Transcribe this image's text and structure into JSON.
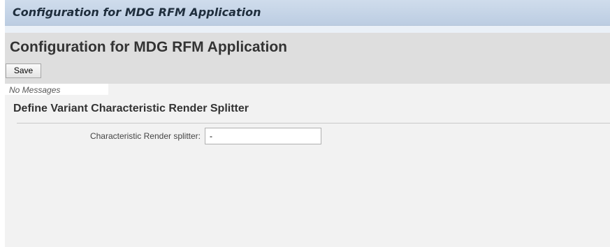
{
  "window": {
    "title": "Configuration for MDG RFM Application"
  },
  "header": {
    "page_title": "Configuration for MDG RFM Application",
    "save_label": "Save"
  },
  "messages": {
    "text": "No Messages"
  },
  "section": {
    "title": "Define Variant Characteristic Render Splitter",
    "fields": [
      {
        "label": "Characteristic Render splitter:",
        "value": "-"
      }
    ]
  }
}
